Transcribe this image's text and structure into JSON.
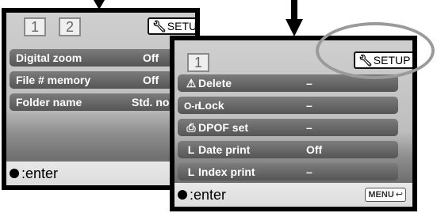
{
  "left_screen": {
    "tabs": [
      "1",
      "2"
    ],
    "setup_label": "SETUP",
    "rows": [
      {
        "label": "Digital zoom",
        "value": "Off"
      },
      {
        "label": "File # memory",
        "value": "Off"
      },
      {
        "label": "Folder name",
        "value": "Std. nor"
      }
    ],
    "enter_label": ":enter"
  },
  "right_screen": {
    "tabs": [
      "1"
    ],
    "setup_label": "SETUP",
    "rows": [
      {
        "icon": "⚠",
        "label": "Delete",
        "value": "–"
      },
      {
        "icon": "O‑n",
        "label": "Lock",
        "value": "–"
      },
      {
        "icon": "⎙",
        "label": "DPOF set",
        "value": "–"
      },
      {
        "icon": "L",
        "label": "Date print",
        "value": "Off"
      },
      {
        "icon": "L",
        "label": "Index print",
        "value": "–"
      }
    ],
    "enter_label": ":enter",
    "menu_button": "MENU"
  },
  "colors": {
    "frame": "#000000",
    "row_bg": "#666666",
    "row_text": "#ffffff",
    "highlight": "#9a9a9a"
  },
  "icons": [
    "arrow-down-icon",
    "wrench-icon",
    "warning-icon",
    "key-icon",
    "print-icon",
    "sub-item-icon",
    "return-icon"
  ]
}
